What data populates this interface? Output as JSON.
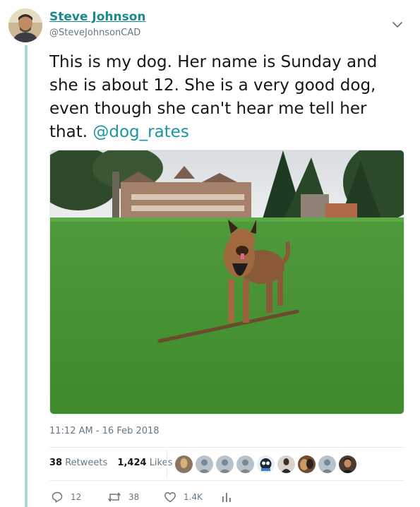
{
  "author": {
    "display_name": "Steve Johnson",
    "handle": "@SteveJohnsonCAD",
    "avatar_icon": "profile-photo"
  },
  "tweet": {
    "text": "This is my dog. Her name is Sunday and she is about 12. She is a very good dog, even though she can't hear me tell her that.",
    "mention": "@dog_rates",
    "timestamp": "11:12 AM - 16 Feb 2018"
  },
  "stats": {
    "retweets_count": "38",
    "retweets_label": "Retweets",
    "likes_count": "1,424",
    "likes_label": "Likes"
  },
  "actions": {
    "reply_count": "12",
    "retweet_count": "38",
    "like_count": "1.4K"
  },
  "colors": {
    "accent": "#1b95a0",
    "name_link": "#1a8a8a",
    "muted": "#657786",
    "thread_line": "#a8d8df"
  }
}
